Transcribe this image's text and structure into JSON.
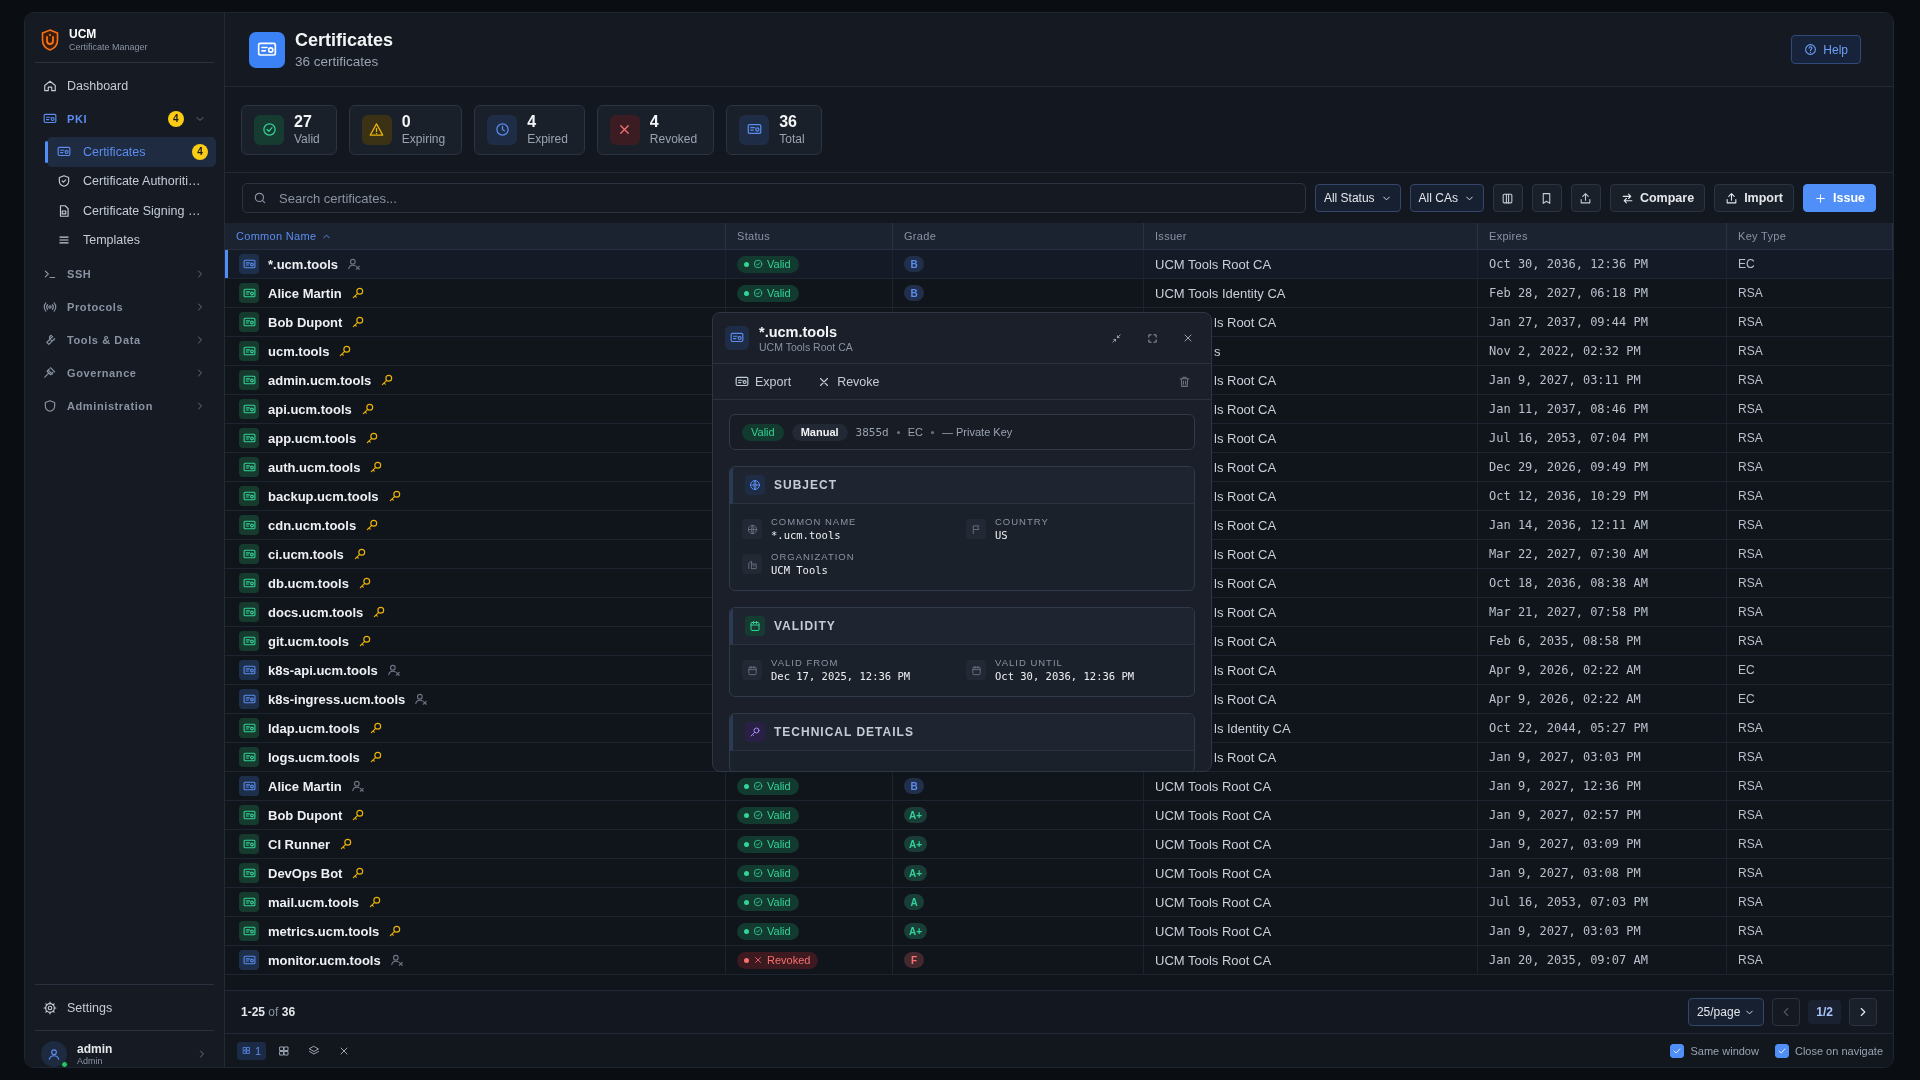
{
  "sidebar": {
    "app_name": "UCM",
    "app_subtitle": "Certificate Manager",
    "nav": [
      {
        "label": "Dashboard",
        "kind": "link",
        "selected": false
      },
      {
        "label": "PKI",
        "kind": "group",
        "expanded": true,
        "badge": "4",
        "children": [
          {
            "label": "Certificates",
            "selected": true,
            "badge": "4"
          },
          {
            "label": "Certificate Authoriti…",
            "selected": false
          },
          {
            "label": "Certificate Signing …",
            "selected": false
          },
          {
            "label": "Templates",
            "selected": false
          }
        ]
      },
      {
        "label": "SSH",
        "kind": "group",
        "expanded": false
      },
      {
        "label": "Protocols",
        "kind": "group",
        "expanded": false
      },
      {
        "label": "Tools & Data",
        "kind": "group",
        "expanded": false
      },
      {
        "label": "Governance",
        "kind": "group",
        "expanded": false
      },
      {
        "label": "Administration",
        "kind": "group",
        "expanded": false
      }
    ],
    "settings": "Settings",
    "user": {
      "name": "admin",
      "role": "Admin",
      "online": true
    }
  },
  "header": {
    "title": "Certificates",
    "subtitle": "36 certificates",
    "help": "Help"
  },
  "stats": [
    {
      "value": "27",
      "label": "Valid",
      "kind": "valid"
    },
    {
      "value": "0",
      "label": "Expiring",
      "kind": "expiring"
    },
    {
      "value": "4",
      "label": "Expired",
      "kind": "expired"
    },
    {
      "value": "4",
      "label": "Revoked",
      "kind": "revoked"
    },
    {
      "value": "36",
      "label": "Total",
      "kind": "total"
    }
  ],
  "toolbar": {
    "search": {
      "placeholder": "Search certificates..."
    },
    "filters": [
      "All Status",
      "All CAs"
    ],
    "buttons": [
      {
        "label": "Compare",
        "kind": "compare"
      },
      {
        "label": "Import",
        "kind": "import"
      },
      {
        "label": "Issue",
        "kind": "primary"
      }
    ]
  },
  "table": {
    "columns": [
      {
        "label": "Common Name",
        "sorted": true
      },
      {
        "label": "Status",
        "sorted": false
      },
      {
        "label": "Grade",
        "sorted": false
      },
      {
        "label": "Issuer",
        "sorted": false
      },
      {
        "label": "Expires",
        "sorted": false
      },
      {
        "label": "Key Type",
        "sorted": false
      }
    ],
    "rows": [
      {
        "name": "*.ucm.tools",
        "private_key": false,
        "selected": true,
        "status": {
          "label": "Valid",
          "kind": "valid"
        },
        "grade": {
          "label": "B",
          "color": "#5b8def"
        },
        "issuer": "UCM Tools Root CA",
        "expires": "Oct 30, 2036, 12:36 PM",
        "key_type": "EC"
      },
      {
        "name": "Alice Martin",
        "private_key": true,
        "selected": false,
        "status": {
          "label": "Valid",
          "kind": "valid"
        },
        "grade": {
          "label": "B",
          "color": "#5b8def"
        },
        "issuer": "UCM Tools Identity CA",
        "expires": "Feb 28, 2027, 06:18 PM",
        "key_type": "RSA"
      },
      {
        "name": "Bob Dupont",
        "private_key": true,
        "selected": false,
        "issuer": "ls Root CA",
        "expires": "Jan 27, 2037, 09:44 PM",
        "key_type": "RSA"
      },
      {
        "name": "ucm.tools",
        "private_key": true,
        "selected": false,
        "issuer": "s",
        "expires": "Nov 2, 2022, 02:32 PM",
        "key_type": "RSA"
      },
      {
        "name": "admin.ucm.tools",
        "private_key": true,
        "selected": false,
        "issuer": "ls Root CA",
        "expires": "Jan 9, 2027, 03:11 PM",
        "key_type": "RSA"
      },
      {
        "name": "api.ucm.tools",
        "private_key": true,
        "selected": false,
        "issuer": "ls Root CA",
        "expires": "Jan 11, 2037, 08:46 PM",
        "key_type": "RSA"
      },
      {
        "name": "app.ucm.tools",
        "private_key": true,
        "selected": false,
        "issuer": "ls Root CA",
        "expires": "Jul 16, 2053, 07:04 PM",
        "key_type": "RSA"
      },
      {
        "name": "auth.ucm.tools",
        "private_key": true,
        "selected": false,
        "issuer": "ls Root CA",
        "expires": "Dec 29, 2026, 09:49 PM",
        "key_type": "RSA"
      },
      {
        "name": "backup.ucm.tools",
        "private_key": true,
        "selected": false,
        "issuer": "ls Root CA",
        "expires": "Oct 12, 2036, 10:29 PM",
        "key_type": "RSA"
      },
      {
        "name": "cdn.ucm.tools",
        "private_key": true,
        "selected": false,
        "issuer": "ls Root CA",
        "expires": "Jan 14, 2036, 12:11 AM",
        "key_type": "RSA"
      },
      {
        "name": "ci.ucm.tools",
        "private_key": true,
        "selected": false,
        "issuer": "ls Root CA",
        "expires": "Mar 22, 2027, 07:30 AM",
        "key_type": "RSA"
      },
      {
        "name": "db.ucm.tools",
        "private_key": true,
        "selected": false,
        "issuer": "ls Root CA",
        "expires": "Oct 18, 2036, 08:38 AM",
        "key_type": "RSA"
      },
      {
        "name": "docs.ucm.tools",
        "private_key": true,
        "selected": false,
        "issuer": "ls Root CA",
        "expires": "Mar 21, 2027, 07:58 PM",
        "key_type": "RSA"
      },
      {
        "name": "git.ucm.tools",
        "private_key": true,
        "selected": false,
        "issuer": "ls Root CA",
        "expires": "Feb 6, 2035, 08:58 PM",
        "key_type": "RSA"
      },
      {
        "name": "k8s-api.ucm.tools",
        "private_key": false,
        "selected": false,
        "issuer": "ls Root CA",
        "expires": "Apr 9, 2026, 02:22 AM",
        "key_type": "EC"
      },
      {
        "name": "k8s-ingress.ucm.tools",
        "private_key": false,
        "selected": false,
        "issuer": "ls Root CA",
        "expires": "Apr 9, 2026, 02:22 AM",
        "key_type": "EC"
      },
      {
        "name": "ldap.ucm.tools",
        "private_key": true,
        "selected": false,
        "issuer": "ls Identity CA",
        "expires": "Oct 22, 2044, 05:27 PM",
        "key_type": "RSA"
      },
      {
        "name": "logs.ucm.tools",
        "private_key": true,
        "selected": false,
        "issuer": "ls Root CA",
        "expires": "Jan 9, 2027, 03:03 PM",
        "key_type": "RSA"
      },
      {
        "name": "Alice Martin",
        "private_key": false,
        "selected": false,
        "status": {
          "label": "Valid",
          "kind": "valid"
        },
        "grade": {
          "label": "B",
          "color": "#5b8def"
        },
        "issuer": "UCM Tools Root CA",
        "expires": "Jan 9, 2027, 12:36 PM",
        "key_type": "RSA"
      },
      {
        "name": "Bob Dupont",
        "private_key": true,
        "selected": false,
        "status": {
          "label": "Valid",
          "kind": "valid"
        },
        "grade": {
          "label": "A+",
          "color": "#34d399"
        },
        "issuer": "UCM Tools Root CA",
        "expires": "Jan 9, 2027, 02:57 PM",
        "key_type": "RSA"
      },
      {
        "name": "CI Runner",
        "private_key": true,
        "selected": false,
        "status": {
          "label": "Valid",
          "kind": "valid"
        },
        "grade": {
          "label": "A+",
          "color": "#34d399"
        },
        "issuer": "UCM Tools Root CA",
        "expires": "Jan 9, 2027, 03:09 PM",
        "key_type": "RSA"
      },
      {
        "name": "DevOps Bot",
        "private_key": true,
        "selected": false,
        "status": {
          "label": "Valid",
          "kind": "valid"
        },
        "grade": {
          "label": "A+",
          "color": "#34d399"
        },
        "issuer": "UCM Tools Root CA",
        "expires": "Jan 9, 2027, 03:08 PM",
        "key_type": "RSA"
      },
      {
        "name": "mail.ucm.tools",
        "private_key": true,
        "selected": false,
        "status": {
          "label": "Valid",
          "kind": "valid"
        },
        "grade": {
          "label": "A",
          "color": "#34d399"
        },
        "issuer": "UCM Tools Root CA",
        "expires": "Jul 16, 2053, 07:03 PM",
        "key_type": "RSA"
      },
      {
        "name": "metrics.ucm.tools",
        "private_key": true,
        "selected": false,
        "status": {
          "label": "Valid",
          "kind": "valid"
        },
        "grade": {
          "label": "A+",
          "color": "#34d399"
        },
        "issuer": "UCM Tools Root CA",
        "expires": "Jan 9, 2027, 03:03 PM",
        "key_type": "RSA"
      },
      {
        "name": "monitor.ucm.tools",
        "private_key": false,
        "selected": false,
        "status": {
          "label": "Revoked",
          "kind": "revoked"
        },
        "grade": {
          "label": "F",
          "color": "#f87171"
        },
        "issuer": "UCM Tools Root CA",
        "expires": "Jan 20, 2035, 09:07 AM",
        "key_type": "RSA"
      }
    ]
  },
  "modal": {
    "title": "*.ucm.tools",
    "subtitle": "UCM Tools Root CA",
    "actions": [
      {
        "label": "Export",
        "kind": "export"
      },
      {
        "label": "Revoke",
        "kind": "revoke"
      }
    ],
    "summary": {
      "status": {
        "label": "Valid",
        "kind": "valid"
      },
      "origin": "Manual",
      "details": [
        "3855d",
        "EC",
        "— Private Key"
      ]
    },
    "sections": [
      {
        "title": "SUBJECT",
        "kind": "subject",
        "fields": [
          {
            "label": "COMMON NAME",
            "value": "*.ucm.tools",
            "kind": "name"
          },
          {
            "label": "COUNTRY",
            "value": "US",
            "kind": "country"
          },
          {
            "label": "ORGANIZATION",
            "value": "UCM Tools",
            "kind": "organization"
          }
        ]
      },
      {
        "title": "VALIDITY",
        "kind": "validity",
        "fields": [
          {
            "label": "VALID FROM",
            "value": "Dec 17, 2025, 12:36 PM",
            "kind": "date"
          },
          {
            "label": "VALID UNTIL",
            "value": "Oct 30, 2036, 12:36 PM",
            "kind": "date"
          }
        ]
      },
      {
        "title": "TECHNICAL DETAILS",
        "kind": "technical"
      }
    ]
  },
  "footer": {
    "range": "**1-25** of **36**",
    "per_page": "25/page",
    "page": "1/2",
    "prev_disabled": true,
    "next_disabled": false
  },
  "bottom_bar": {
    "windows": "1",
    "options": [
      {
        "label": "Same window",
        "checked": true
      },
      {
        "label": "Close on navigate",
        "checked": true
      }
    ]
  }
}
